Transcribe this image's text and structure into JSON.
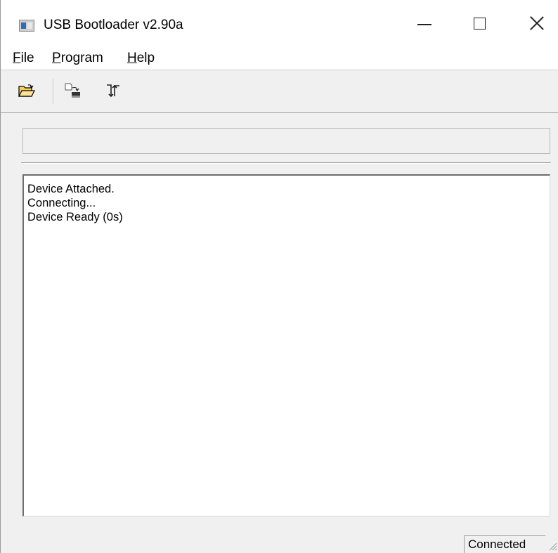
{
  "window": {
    "title": "USB Bootloader v2.90a",
    "app_icon": "app-window-icon"
  },
  "titlebar_buttons": {
    "minimize_icon": "minimize-icon",
    "maximize_icon": "maximize-icon",
    "close_icon": "close-icon"
  },
  "menu": {
    "file": {
      "mnemonic": "F",
      "rest": "ile"
    },
    "program": {
      "mnemonic": "P",
      "rest": "rogram"
    },
    "help": {
      "mnemonic": "H",
      "rest": "elp"
    }
  },
  "toolbar": {
    "items": [
      "open-folder-icon",
      "program-device-icon",
      "reset-device-icon"
    ]
  },
  "progress": {
    "value": 0
  },
  "log": {
    "lines": [
      "Device Attached.",
      "Connecting...",
      "Device Ready (0s)"
    ]
  },
  "statusbar": {
    "status": "Connected"
  },
  "colors": {
    "window_bg": "#f0f0f0",
    "titlebar_bg": "#ffffff",
    "progress_fill": "#06b025"
  }
}
